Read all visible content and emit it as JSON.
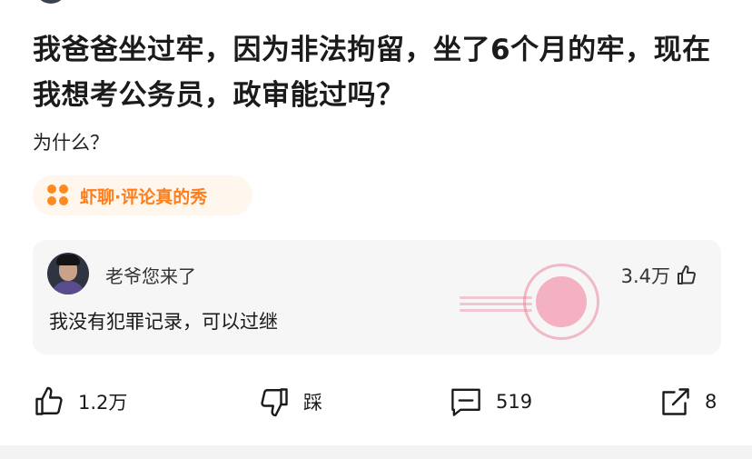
{
  "question": {
    "title": "我爸爸坐过牢，因为非法拘留，坐了6个月的牢，现在我想考公务员，政审能过吗？",
    "description": "为什么？"
  },
  "topic": {
    "label": "虾聊·评论真的秀",
    "icon": "four-dots-icon",
    "color": "#ff7e1b"
  },
  "hot_comment": {
    "author": "老爷您来了",
    "likes": "3.4万",
    "text": "我没有犯罪记录，可以过继"
  },
  "actions": {
    "like_count": "1.2万",
    "dislike_label": "踩",
    "comment_count": "519",
    "share_count": "8"
  }
}
